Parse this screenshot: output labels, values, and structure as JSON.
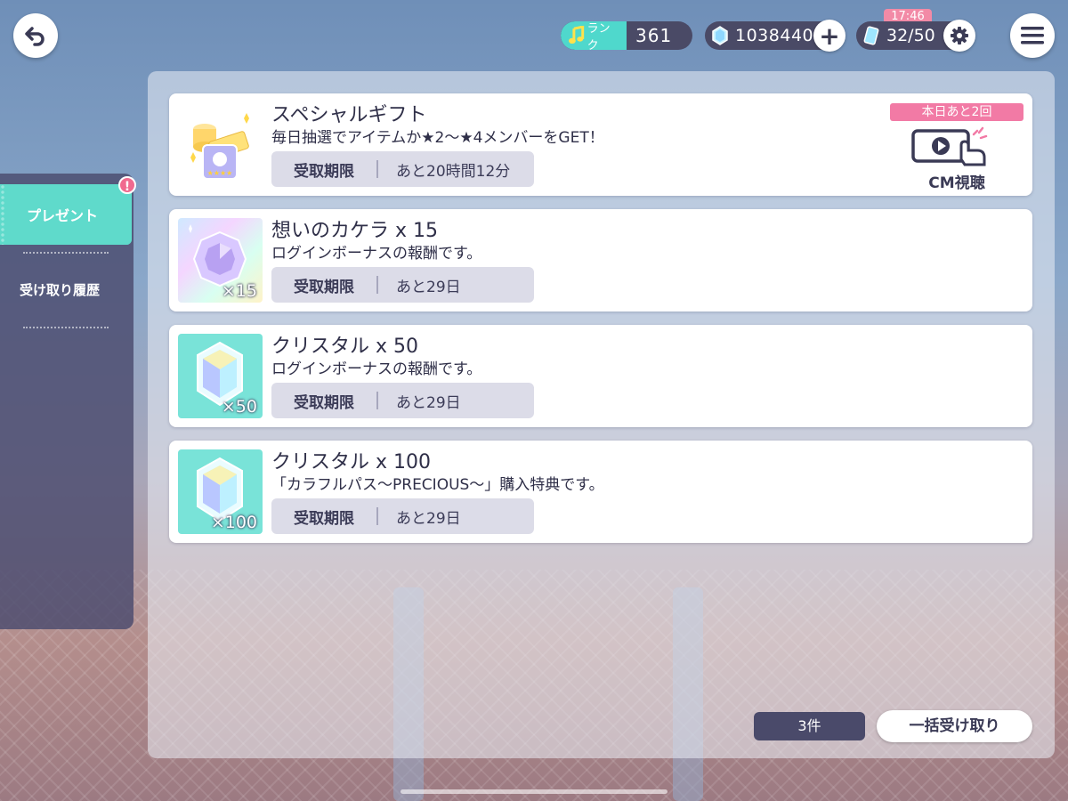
{
  "header": {
    "rank_label": "ランク",
    "rank_value": "361",
    "crystals": "1038440",
    "stamina": "32/50",
    "stamina_timer": "17:46"
  },
  "sidebar": {
    "items": [
      {
        "label": "プレゼント",
        "active": true,
        "badge": "!"
      },
      {
        "label": "受け取り履歴",
        "active": false
      }
    ]
  },
  "special_gift": {
    "title": "スペシャルギフト",
    "description": "毎日抽選でアイテムか★2〜★4メンバーをGET！",
    "deadline_label": "受取期限",
    "deadline_value": "あと20時間12分",
    "daily_remaining": "本日あと2回",
    "cm_label": "CM視聴"
  },
  "presents": [
    {
      "title": "想いのカケラ x 15",
      "description": "ログインボーナスの報酬です。",
      "qty": "×15",
      "deadline_label": "受取期限",
      "deadline_value": "あと29日",
      "icon": "kakera-gem-icon"
    },
    {
      "title": "クリスタル x 50",
      "description": "ログインボーナスの報酬です。",
      "qty": "×50",
      "deadline_label": "受取期限",
      "deadline_value": "あと29日",
      "icon": "crystal-icon"
    },
    {
      "title": "クリスタル x 100",
      "description": "「カラフルパス〜PRECIOUS〜」購入特典です。",
      "qty": "×100",
      "deadline_label": "受取期限",
      "deadline_value": "あと29日",
      "icon": "crystal-icon"
    }
  ],
  "footer": {
    "count": "3件",
    "claim_all": "一括受け取り"
  },
  "colors": {
    "accent": "#5fdacb",
    "pink": "#f27aa5",
    "dark": "#4a4a6a"
  }
}
